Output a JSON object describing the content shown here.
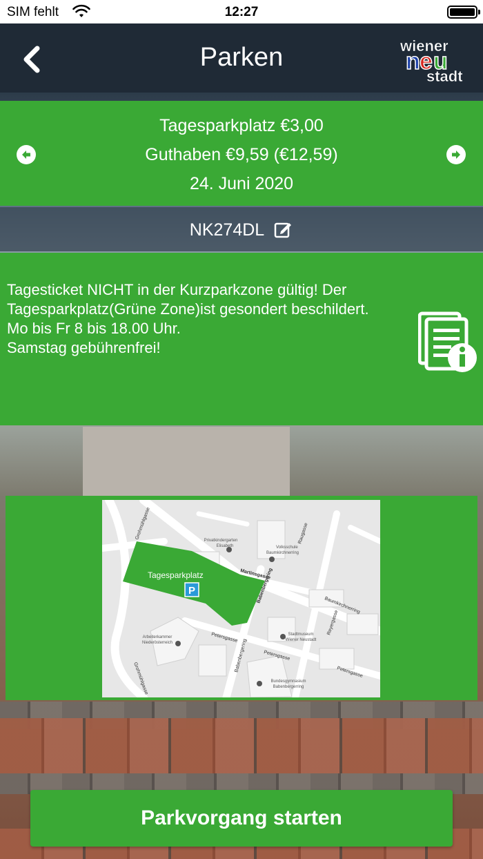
{
  "status_bar": {
    "carrier": "SIM fehlt",
    "time": "12:27",
    "icons": [
      "wifi-icon",
      "battery-icon"
    ]
  },
  "nav": {
    "title": "Parken",
    "back_icon": "chevron-left-icon",
    "logo": {
      "line1": "wiener",
      "line2": "neu",
      "line3": "stadt"
    }
  },
  "summary": {
    "zone_price": "Tagesparkplatz €3,00",
    "balance": "Guthaben €9,59 (€12,59)",
    "date": "24. Juni 2020",
    "prev_icon": "arrow-left-circle-icon",
    "next_icon": "arrow-right-circle-icon"
  },
  "plate": {
    "number": "NK274DL",
    "edit_icon": "edit-icon"
  },
  "info": {
    "lines": [
      "Tagesticket NICHT in der Kurzparkzone gültig! Der Tagesparkplatz(Grüne Zone)ist gesondert beschildert.",
      "Mo bis Fr 8 bis 18.00 Uhr.",
      "Samstag gebührenfrei!"
    ],
    "doc_icon": "document-info-icon"
  },
  "map": {
    "zone_label": "Tagesparkplatz",
    "parking_symbol": "P",
    "streets": {
      "grohmuehlgasse_top": "Grohmühlgasse",
      "grohmuehlgasse_bottom": "Grohmühlgasse",
      "martinsgasse": "Martinsgasse",
      "babenbergering_top": "Babenbergering",
      "babenbergering_mid": "Babenbergering",
      "raugasse": "Raugasse",
      "baumkirchnerring": "Baumkirchnerring",
      "reyergasse": "Reyergasse",
      "petersgasse_left": "Petersgasse",
      "petersgasse_mid": "Petersgasse",
      "petersgasse_right": "Petersgasse"
    },
    "pois": {
      "kindergarten_1": "Privatkindergarten",
      "kindergarten_2": "Elisabeth",
      "volksschule_1": "Volksschule",
      "volksschule_2": "Baumkirchnerring",
      "arbeiterkammer_1": "Arbeiterkammer",
      "arbeiterkammer_2": "Niederösterreich",
      "stadtmuseum_1": "Stadtmuseum",
      "stadtmuseum_2": "Wiener Neustadt",
      "gymnasium_1": "Bundesgymnasium",
      "gymnasium_2": "Babenbergerring"
    }
  },
  "actions": {
    "start_label": "Parkvorgang starten"
  },
  "colors": {
    "green": "#3aa935",
    "navbar": "#1f2a36",
    "plate_bar": "#3a4856",
    "map_bg": "#e7e7e7"
  }
}
